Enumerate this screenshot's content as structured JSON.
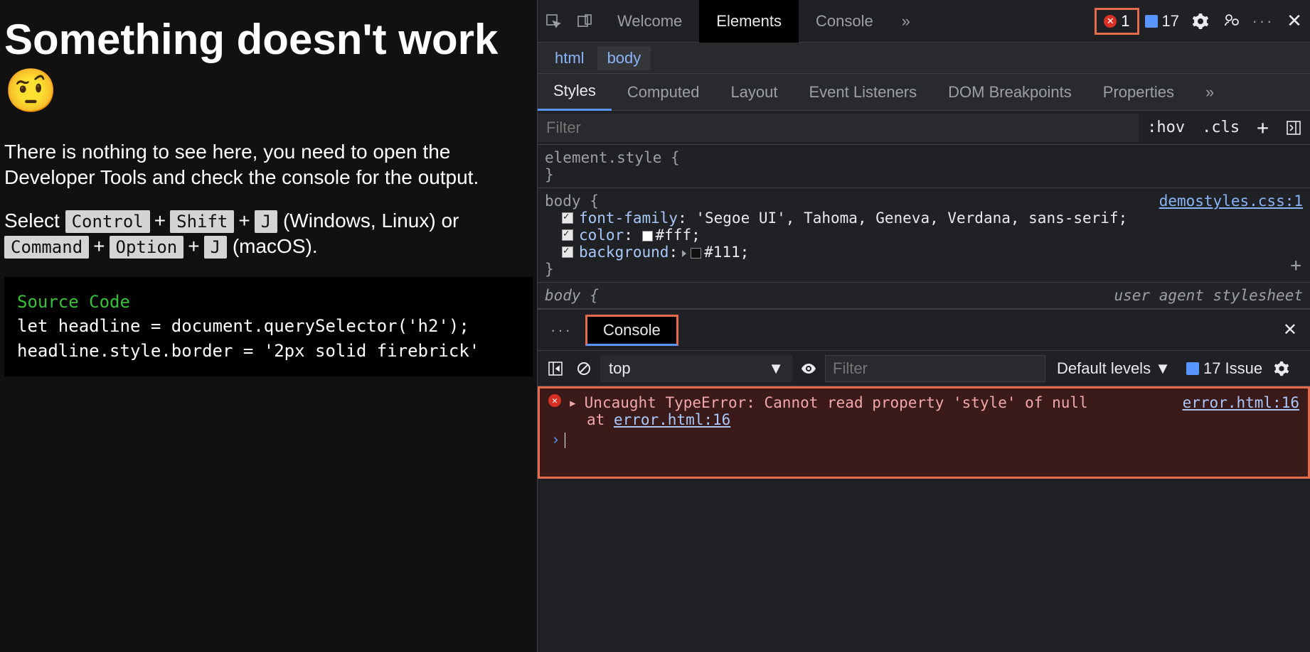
{
  "page": {
    "heading": "Something doesn't work 🤨",
    "para1": "There is nothing to see here, you need to open the Developer Tools and check the console for the output.",
    "select_prefix": "Select ",
    "kbd_ctrl": "Control",
    "kbd_shift": "Shift",
    "kbd_j": "J",
    "winlinux_suffix": " (Windows, Linux) or ",
    "kbd_cmd": "Command",
    "kbd_opt": "Option",
    "macos_suffix": " (macOS).",
    "code_title": "Source Code",
    "code_body": "let headline = document.querySelector('h2');\nheadline.style.border = '2px solid firebrick'"
  },
  "devtools": {
    "tabs": {
      "welcome": "Welcome",
      "elements": "Elements",
      "console": "Console"
    },
    "error_count": "1",
    "issue_count": "17",
    "breadcrumbs": {
      "html": "html",
      "body": "body"
    },
    "styles_tabs": {
      "styles": "Styles",
      "computed": "Computed",
      "layout": "Layout",
      "listeners": "Event Listeners",
      "dom_bp": "DOM Breakpoints",
      "properties": "Properties"
    },
    "filter_placeholder": "Filter",
    "hov": ":hov",
    "cls": ".cls",
    "element_style": "element.style {",
    "close_brace": "}",
    "body_selector": "body {",
    "css_link": "demostyles.css:1",
    "props": {
      "font_family_name": "font-family",
      "font_family_val": ": 'Segoe UI', Tahoma, Geneva, Verdana, sans-serif;",
      "color_name": "color",
      "color_val": "#fff;",
      "bg_name": "background",
      "bg_val": "#111;"
    },
    "ua_label": "user agent stylesheet",
    "console": {
      "tab": "Console",
      "context": "top",
      "filter_ph": "Filter",
      "levels": "Default levels ▼",
      "issues": "17 Issue",
      "err_msg": "Uncaught TypeError: Cannot read property 'style' of null",
      "err_src": "error.html:16",
      "err_stack_prefix": "at ",
      "err_stack_link": "error.html:16",
      "prompt": "›"
    }
  }
}
